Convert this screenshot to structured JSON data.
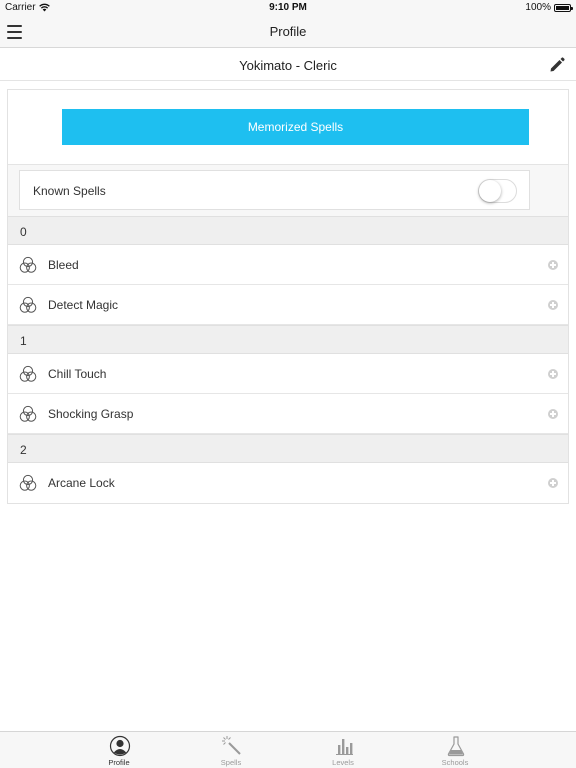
{
  "status_bar": {
    "carrier": "Carrier",
    "time": "9:10 PM",
    "battery": "100%"
  },
  "nav": {
    "title": "Profile",
    "menu_icon": "hamburger-icon"
  },
  "character": {
    "name": "Yokimato - Cleric",
    "edit_icon": "pencil-icon"
  },
  "memorized_button": {
    "label": "Memorized Spells",
    "color": "#1ebff0"
  },
  "known_spells": {
    "label": "Known Spells",
    "toggle_on": false
  },
  "spell_levels": [
    {
      "level": "0",
      "spells": [
        {
          "name": "Bleed",
          "icon": "school-circles-icon",
          "action_icon": "add-circle-icon"
        },
        {
          "name": "Detect Magic",
          "icon": "school-circles-icon",
          "action_icon": "add-circle-icon"
        }
      ]
    },
    {
      "level": "1",
      "spells": [
        {
          "name": "Chill Touch",
          "icon": "school-circles-icon",
          "action_icon": "add-circle-icon"
        },
        {
          "name": "Shocking Grasp",
          "icon": "school-circles-icon",
          "action_icon": "add-circle-icon"
        }
      ]
    },
    {
      "level": "2",
      "spells": [
        {
          "name": "Arcane Lock",
          "icon": "school-circles-icon",
          "action_icon": "add-circle-icon"
        }
      ]
    }
  ],
  "tabs": [
    {
      "label": "Profile",
      "icon": "profile-icon",
      "active": true
    },
    {
      "label": "Spells",
      "icon": "magic-wand-icon",
      "active": false
    },
    {
      "label": "Levels",
      "icon": "bar-chart-icon",
      "active": false
    },
    {
      "label": "Schools",
      "icon": "flask-icon",
      "active": false
    }
  ]
}
